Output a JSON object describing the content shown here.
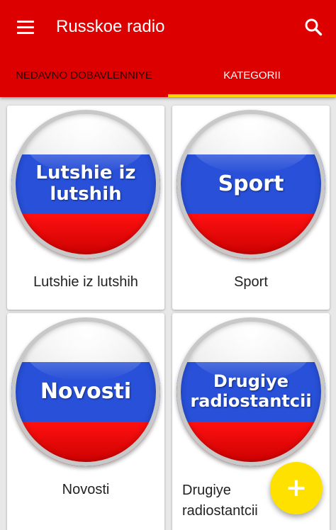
{
  "app": {
    "title": "Russkoe radio"
  },
  "toolbar": {
    "menu_icon": "hamburger-menu-icon",
    "search_icon": "search-icon"
  },
  "tabs": [
    {
      "label": "NEDAVNO DOBAVLENNIYE",
      "active": false
    },
    {
      "label": "KATEGORII",
      "active": true
    }
  ],
  "colors": {
    "app_bar": "#dd0000",
    "tab_indicator": "#ffd600",
    "fab": "#ffe100",
    "flag_blue": "#2850d8",
    "flag_red": "#ff1010"
  },
  "categories": [
    {
      "badge_text": "Lutshie iz lutshih",
      "label": "Lutshie iz lutshih"
    },
    {
      "badge_text": "Sport",
      "label": "Sport"
    },
    {
      "badge_text": "Novosti",
      "label": "Novosti"
    },
    {
      "badge_text": "Drugiye radiostantcii",
      "label": "Drugiye radiostantcii"
    }
  ],
  "fab": {
    "icon": "plus-icon",
    "symbol": "+"
  }
}
